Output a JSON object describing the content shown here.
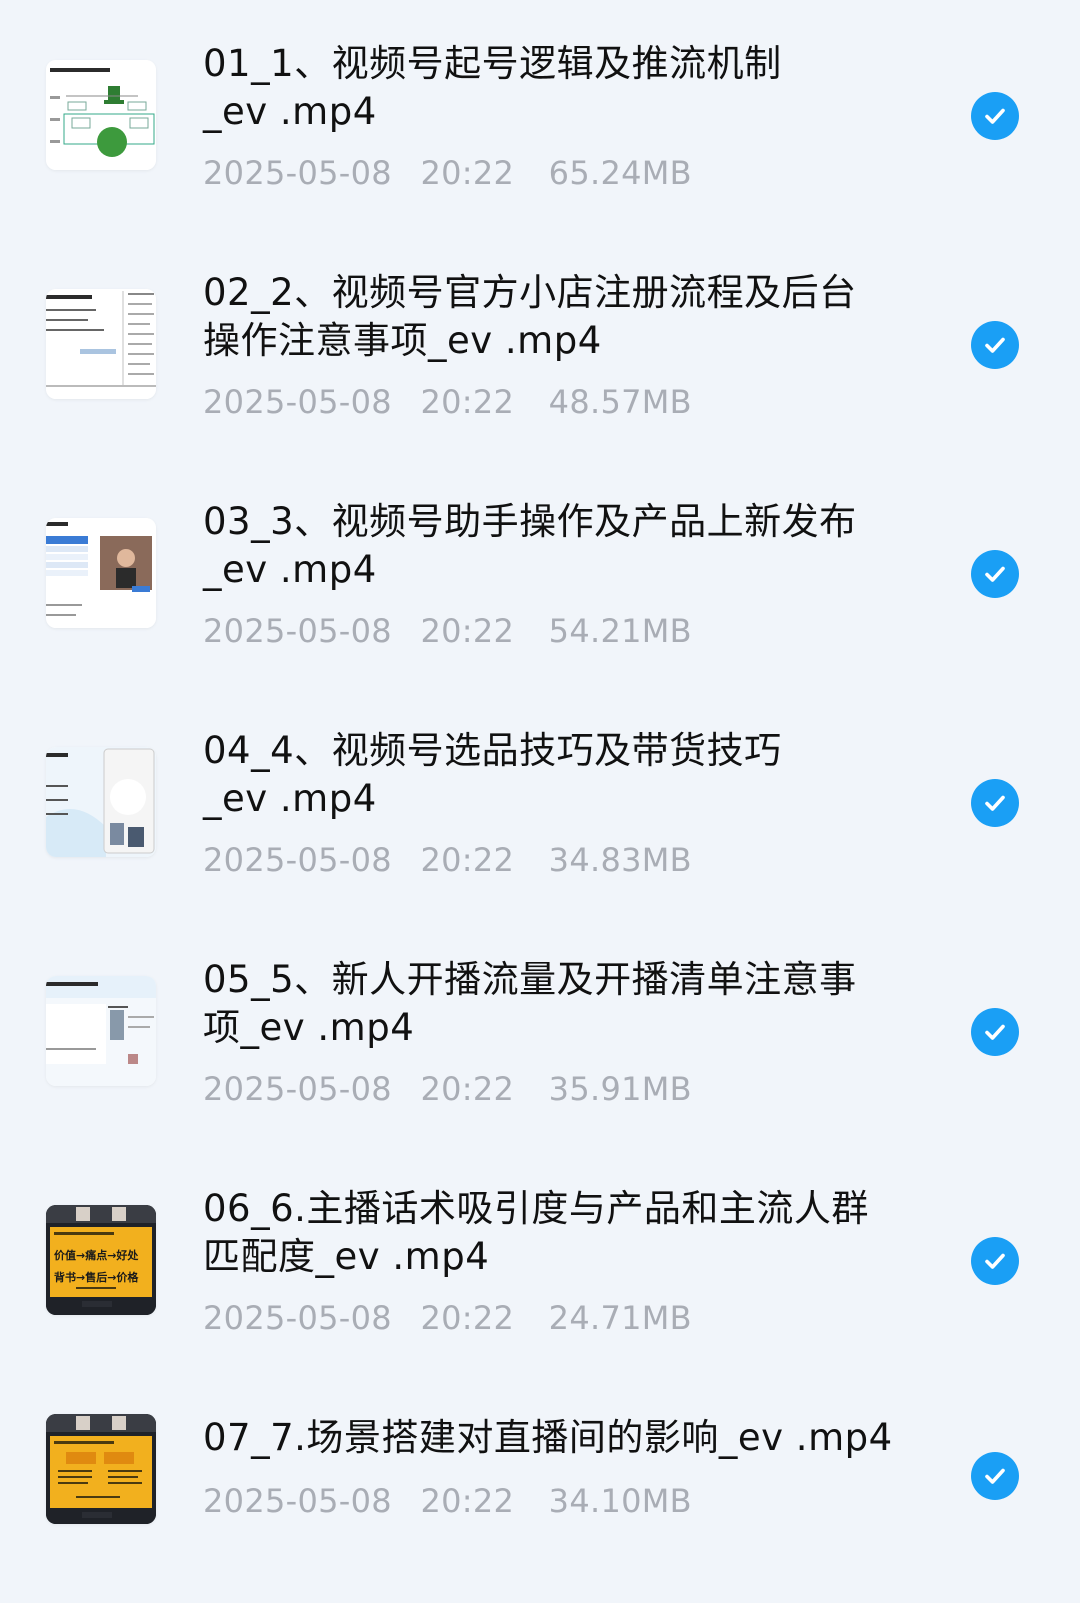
{
  "colors": {
    "background": "#f1f5fa",
    "filename": "#111111",
    "meta": "#a9adb5",
    "check": "#1a9ff5"
  },
  "files": [
    {
      "name": "01_1、视频号起号逻辑及推流机制\n_ev .mp4",
      "date": "2025-05-08",
      "time": "20:22",
      "size": "65.24MB",
      "selected": true,
      "thumbnail_icon": "diagram-slide-thumbnail"
    },
    {
      "name": "02_2、视频号官方小店注册流程及后台\n操作注意事项_ev .mp4",
      "date": "2025-05-08",
      "time": "20:22",
      "size": "48.57MB",
      "selected": true,
      "thumbnail_icon": "text-slide-thumbnail"
    },
    {
      "name": "03_3、视频号助手操作及产品上新发布\n_ev .mp4",
      "date": "2025-05-08",
      "time": "20:22",
      "size": "54.21MB",
      "selected": true,
      "thumbnail_icon": "screenshot-slide-thumbnail"
    },
    {
      "name": "04_4、视频号选品技巧及带货技巧\n_ev .mp4",
      "date": "2025-05-08",
      "time": "20:22",
      "size": "34.83MB",
      "selected": true,
      "thumbnail_icon": "phone-slide-thumbnail"
    },
    {
      "name": "05_5、新人开播流量及开播清单注意事\n项_ev .mp4",
      "date": "2025-05-08",
      "time": "20:22",
      "size": "35.91MB",
      "selected": true,
      "thumbnail_icon": "product-slide-thumbnail"
    },
    {
      "name": "06_6.主播话术吸引度与产品和主流人群\n匹配度_ev .mp4",
      "date": "2025-05-08",
      "time": "20:22",
      "size": "24.71MB",
      "selected": true,
      "thumbnail_icon": "dark-lecture-thumbnail",
      "thumbnail_text": [
        "价值→痛点→好处",
        "背书→售后→价格"
      ]
    },
    {
      "name": "07_7.场景搭建对直播间的影响_ev .mp4",
      "date": "2025-05-08",
      "time": "20:22",
      "size": "34.10MB",
      "selected": true,
      "thumbnail_icon": "dark-lecture-thumbnail"
    }
  ]
}
